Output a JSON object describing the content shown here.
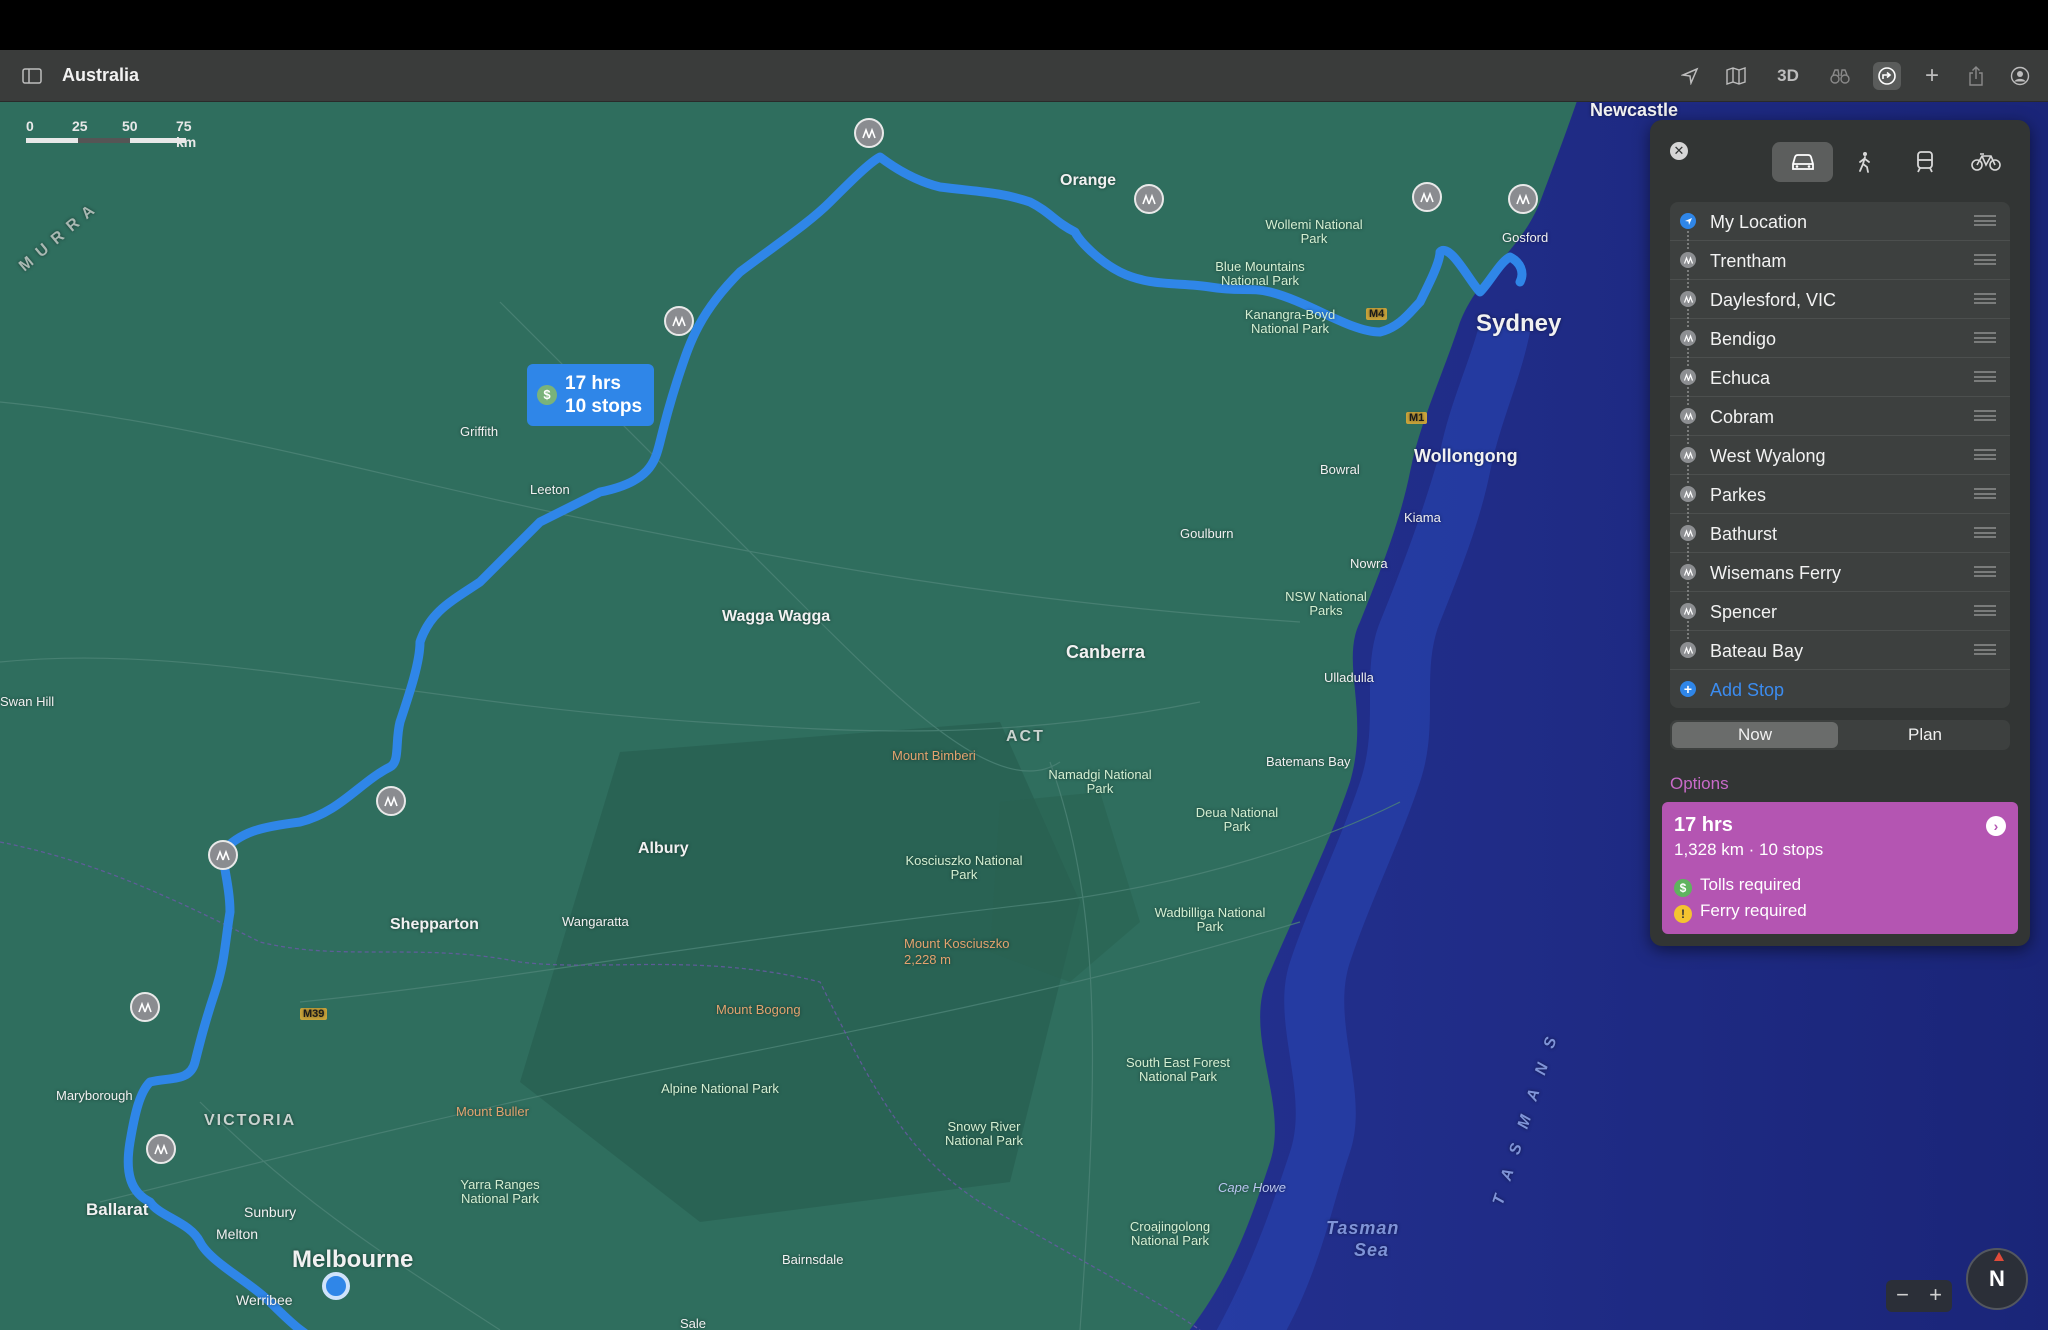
{
  "toolbar": {
    "title": "Australia",
    "view_3d_label": "3D",
    "icons": [
      "sidebar-icon",
      "location-arrow-icon",
      "map-icon",
      "binoculars-icon",
      "directions-icon",
      "plus-icon",
      "share-icon",
      "account-icon"
    ]
  },
  "scale": {
    "ticks": [
      "0",
      "25",
      "50",
      "75 km"
    ]
  },
  "route_badge": {
    "duration": "17 hrs",
    "stops": "10 stops",
    "toll_icon": "$"
  },
  "map_labels": {
    "cities_big": {
      "sydney": "Sydney",
      "melbourne": "Melbourne"
    },
    "cities_med": {
      "canberra": "Canberra",
      "wollongong": "Wollongong",
      "newcastle": "Newcastle"
    },
    "towns": {
      "orange": "Orange",
      "gosford": "Gosford",
      "griffith": "Griffith",
      "leeton": "Leeton",
      "wagga": "Wagga Wagga",
      "albury": "Albury",
      "shepparton": "Shepparton",
      "wangaratta": "Wangaratta",
      "ballarat": "Ballarat",
      "sunbury": "Sunbury",
      "melton": "Melton",
      "werribee": "Werribee",
      "maryborough": "Maryborough",
      "swanhill": "Swan Hill",
      "bowral": "Bowral",
      "goulburn": "Goulburn",
      "kiama": "Kiama",
      "nowra": "Nowra",
      "ulladulla": "Ulladulla",
      "batemans": "Batemans Bay",
      "bairnsdale": "Bairnsdale",
      "sale": "Sale"
    },
    "parks": {
      "wollemi": "Wollemi National Park",
      "bluemtn": "Blue Mountains National Park",
      "kanangra": "Kanangra-Boyd National Park",
      "nsw": "NSW National Parks",
      "namadgi": "Namadgi National Park",
      "deua": "Deua National Park",
      "kosciuszko": "Kosciuszko National Park",
      "wadbilliga": "Wadbilliga National Park",
      "southeast": "South East Forest National Park",
      "alpine": "Alpine National Park",
      "snowy": "Snowy River National Park",
      "yarra": "Yarra Ranges National Park",
      "croajingolong": "Croajingolong National Park"
    },
    "mountains": {
      "bimberi": "Mount Bimberi",
      "kosciuszko": "Mount Kosciuszko",
      "kosciuszko_elev": "2,228 m",
      "bogong": "Mount Bogong",
      "buller": "Mount Buller"
    },
    "regions": {
      "act": "ACT",
      "victoria": "VICTORIA",
      "murray": "M U R R A"
    },
    "seas": {
      "tasman": "Tasman",
      "tasman2": "Sea",
      "tasman_vertical": "T A S M A N   S",
      "cape": "Cape Howe"
    },
    "roads": {
      "m4": "M4",
      "m1": "M1",
      "m39": "M39"
    }
  },
  "directions": {
    "close_label": "✕",
    "modes": [
      "drive",
      "walk",
      "transit",
      "cycle"
    ],
    "active_mode": "drive",
    "stops": [
      "My Location",
      "Trentham",
      "Daylesford, VIC",
      "Bendigo",
      "Echuca",
      "Cobram",
      "West Wyalong",
      "Parkes",
      "Bathurst",
      "Wisemans Ferry",
      "Spencer",
      "Bateau Bay"
    ],
    "add_stop": "Add Stop",
    "segment": {
      "now": "Now",
      "plan": "Plan"
    },
    "options_heading": "Options",
    "option": {
      "duration": "17 hrs",
      "summary": "1,328 km · 10 stops",
      "tolls": "Tolls required",
      "ferry": "Ferry required",
      "toll_glyph": "$",
      "ferry_glyph": "!"
    }
  },
  "controls": {
    "zoom_out": "−",
    "zoom_in": "+",
    "compass": "N"
  },
  "colors": {
    "route": "#2f86e8",
    "option_card": "#b455b2",
    "land": "#2f6e5e",
    "ocean": "#1c2a8a"
  }
}
